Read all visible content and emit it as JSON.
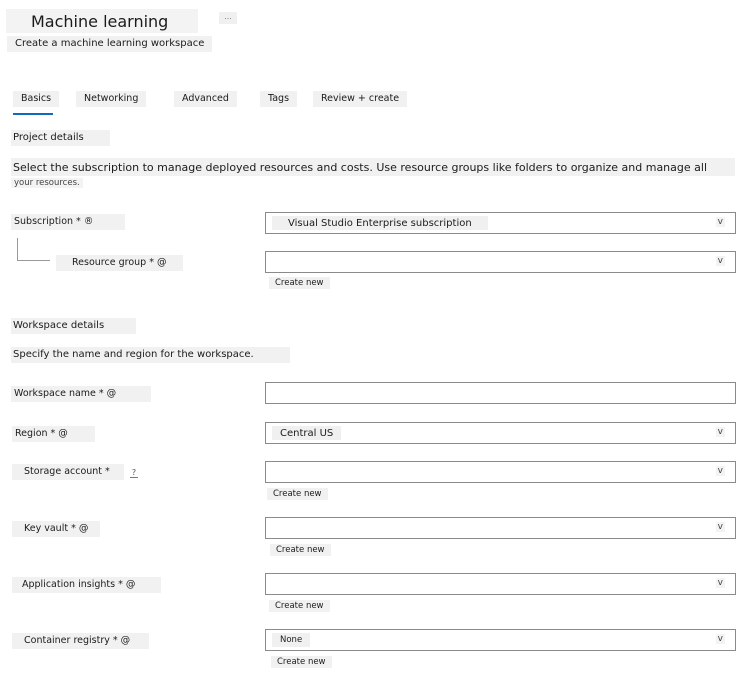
{
  "header": {
    "title": "Machine learning",
    "more": "...",
    "subtitle": "Create a machine learning workspace"
  },
  "tabs": [
    {
      "label": "Basics",
      "active": true
    },
    {
      "label": "Networking"
    },
    {
      "label": "Advanced"
    },
    {
      "label": "Tags"
    },
    {
      "label": "Review + create"
    }
  ],
  "project": {
    "heading": "Project details",
    "description_line1": "Select the subscription to manage deployed resources and costs. Use resource groups like folders to organize and manage all",
    "description_line2": "your resources.",
    "subscription_label": "Subscription * ®",
    "subscription_value": "Visual Studio Enterprise subscription",
    "resource_group_label": "Resource group * @",
    "resource_group_value": "",
    "create_new": "Create new"
  },
  "workspace": {
    "heading": "Workspace details",
    "description": "Specify the name and region for the workspace.",
    "name_label": "Workspace name * @",
    "name_value": "",
    "region_label": "Region * @",
    "region_value": "Central US",
    "storage_label": "Storage account *",
    "storage_help": "?",
    "storage_value": "",
    "storage_create": "Create new",
    "keyvault_label": "Key vault * @",
    "keyvault_value": "",
    "keyvault_create": "Create new",
    "insights_label": "Application insights * @",
    "insights_value": "",
    "insights_create": "Create new",
    "registry_label": "Container registry * @",
    "registry_value": "None",
    "registry_create": "Create new"
  },
  "chevron": "v",
  "colors": {
    "accent": "#0f6cbd",
    "border": "#8a8a8a"
  }
}
